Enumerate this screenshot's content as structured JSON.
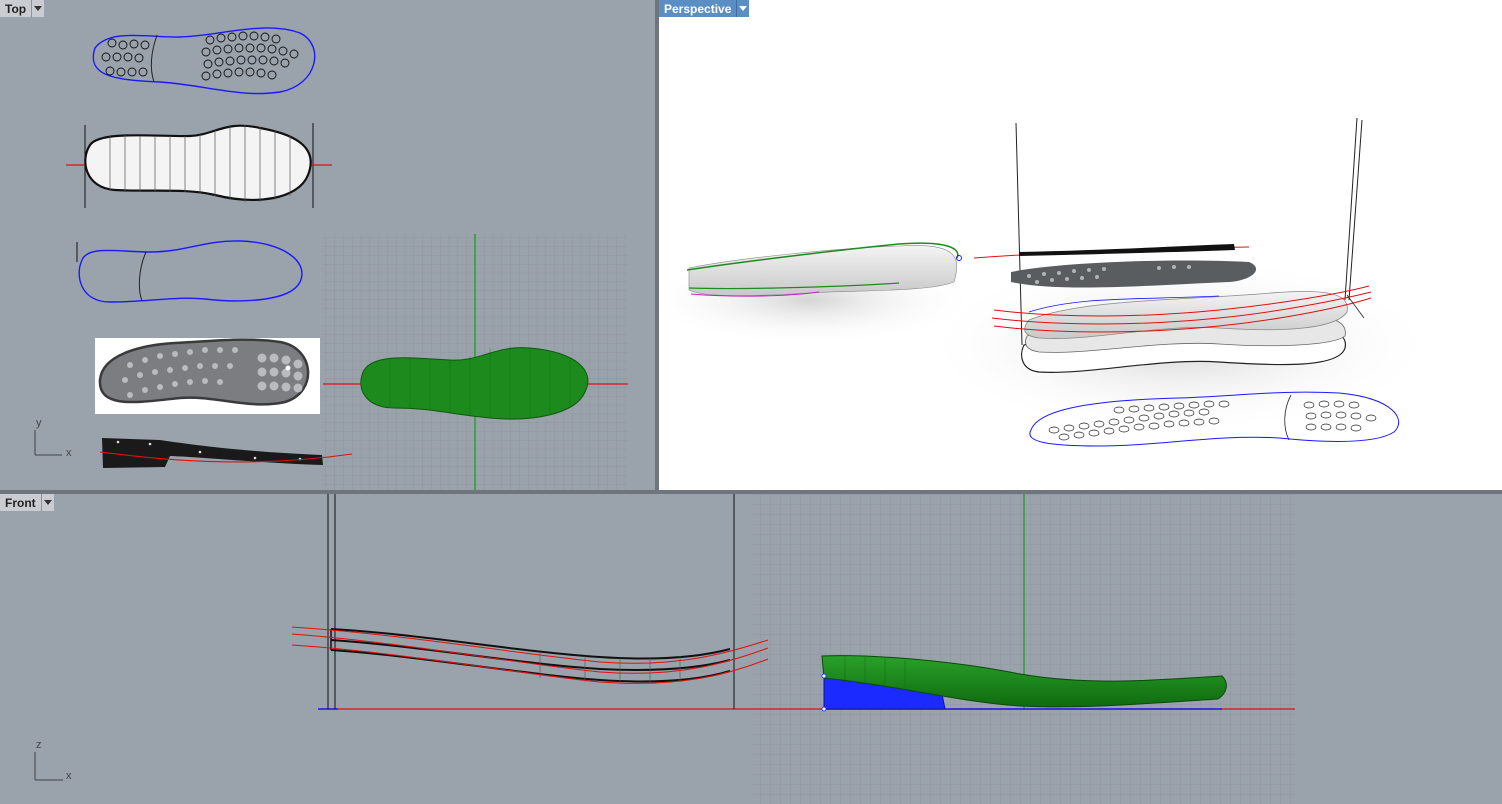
{
  "viewports": {
    "top": {
      "title": "Top",
      "axis_x": "x",
      "axis_y": "y"
    },
    "perspective": {
      "title": "Perspective"
    },
    "front": {
      "title": "Front",
      "axis_x": "x",
      "axis_z": "z"
    }
  },
  "colors": {
    "viewport_bg": "#9aa2ab",
    "perspective_bg": "#ffffff",
    "active_tab": "#5b8fc4",
    "grid_line": "#8d949d",
    "x_axis": "#e01010",
    "y_axis": "#10a010",
    "selected_curve": "#1a1aff",
    "shoe_surface": "#1a8a1a",
    "heel_block": "#1b2bff"
  }
}
